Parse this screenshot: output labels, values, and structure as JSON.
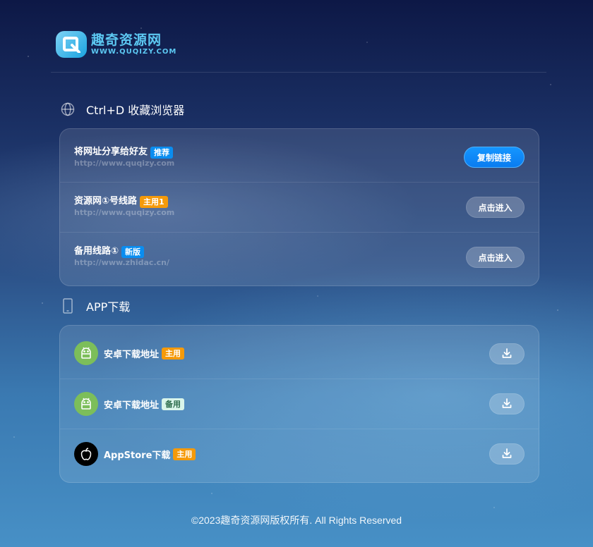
{
  "brand": {
    "name_cn": "趣奇资源网",
    "url_text": "WWW.QUQIZY.COM",
    "accent": "#5cc8f2"
  },
  "sections": {
    "browser": {
      "icon": "globe-icon",
      "title": "Ctrl+D 收藏浏览器",
      "rows": [
        {
          "title": "将网址分享给好友",
          "tag": "推荐",
          "tag_color": "#0a8df0",
          "url": "http://www.quqizy.com",
          "button": "复制链接"
        },
        {
          "title": "资源网①号线路",
          "tag": "主用1",
          "tag_color": "#f59a0a",
          "url": "http://www.quqizy.com",
          "button": "点击进入"
        },
        {
          "title": "备用线路①",
          "tag": "新版",
          "tag_color": "#0a8df0",
          "url": "http://www.zhidac.cn/",
          "button": "点击进入"
        }
      ]
    },
    "app": {
      "icon": "phone-icon",
      "title": "APP下载",
      "rows": [
        {
          "icon": "android-icon",
          "label": "安卓下载地址",
          "tag": "主用",
          "tag_color": "#f59a0a",
          "button_icon": "download-icon"
        },
        {
          "icon": "android-icon",
          "label": "安卓下载地址",
          "tag": "备用",
          "tag_color": "#d9f5ea",
          "button_icon": "download-icon"
        },
        {
          "icon": "apple-icon",
          "label": "AppStore下载",
          "tag": "主用",
          "tag_color": "#f59a0a",
          "button_icon": "download-icon"
        }
      ]
    }
  },
  "footer": "©2023趣奇资源网版权所有. All Rights Reserved"
}
